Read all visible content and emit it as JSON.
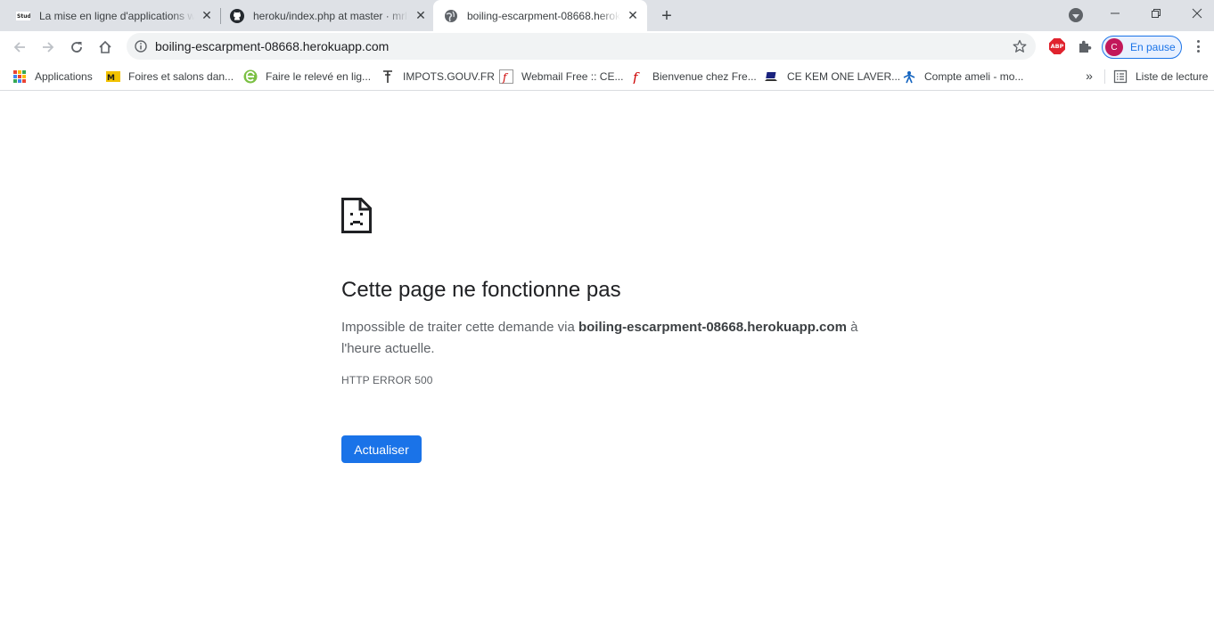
{
  "tabs": [
    {
      "title": "La mise en ligne d'applications w",
      "favicon": "studi-favicon",
      "active": false
    },
    {
      "title": "heroku/index.php at master · mrl",
      "favicon": "github-favicon",
      "active": false
    },
    {
      "title": "boiling-escarpment-08668.heroku",
      "favicon": "globe-favicon",
      "active": true
    }
  ],
  "omnibox": {
    "url": "boiling-escarpment-08668.herokuapp.com"
  },
  "extensions": {
    "abp_label": "ABP"
  },
  "profile": {
    "initial": "C",
    "label": "En pause",
    "color": "#c2185b"
  },
  "bookmarks": {
    "items": [
      {
        "label": "Applications",
        "icon": "apps-grid-icon"
      },
      {
        "label": "Foires et salons dan...",
        "icon": "mp-icon"
      },
      {
        "label": "Faire le relevé en lig...",
        "icon": "e-green-icon"
      },
      {
        "label": "IMPOTS.GOUV.FR",
        "icon": "impots-icon"
      },
      {
        "label": "Webmail Free :: CE...",
        "icon": "free-icon"
      },
      {
        "label": "Bienvenue chez Fre...",
        "icon": "free-red-icon"
      },
      {
        "label": "CE KEM ONE LAVER...",
        "icon": "laptop-icon"
      },
      {
        "label": "Compte ameli - mo...",
        "icon": "ameli-icon"
      }
    ],
    "overflow": "»",
    "reading_list": "Liste de lecture"
  },
  "error_page": {
    "title": "Cette page ne fonctionne pas",
    "message_prefix": "Impossible de traiter cette demande via ",
    "message_host": "boiling-escarpment-08668.herokuapp.com",
    "message_suffix": " à l'heure actuelle.",
    "code": "HTTP ERROR 500",
    "button": "Actualiser"
  },
  "colors": {
    "accent": "#1a73e8",
    "tabstrip": "#dee1e6"
  }
}
